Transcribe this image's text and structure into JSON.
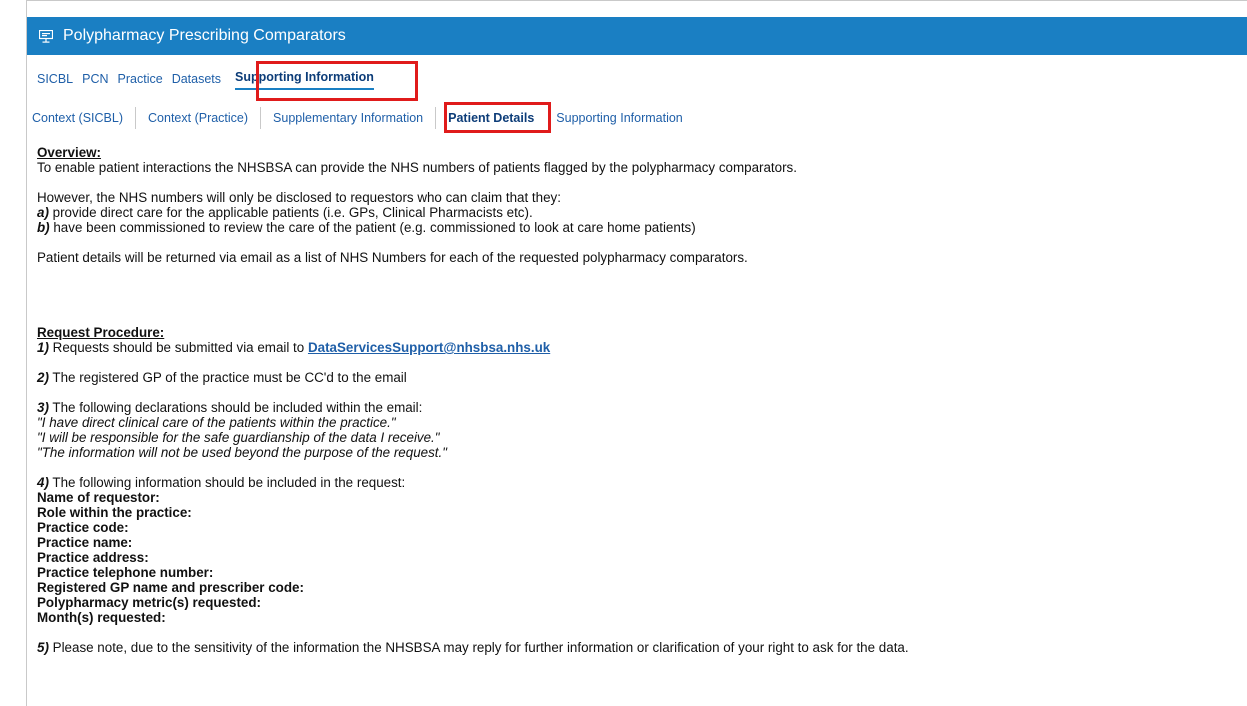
{
  "app": {
    "title": "Polypharmacy Prescribing Comparators",
    "icon": "presentation-board-icon",
    "header_color": "#1a7fc3"
  },
  "nav": {
    "tabs": [
      {
        "label": "SICBL"
      },
      {
        "label": "PCN"
      },
      {
        "label": "Practice"
      },
      {
        "label": "Datasets"
      },
      {
        "label": "Supporting Information",
        "active": true
      }
    ]
  },
  "subnav": {
    "tabs": [
      {
        "label": "Context (SICBL)"
      },
      {
        "label": "Context (Practice)"
      },
      {
        "label": "Supplementary Information"
      },
      {
        "label": "Patient Details",
        "active": true
      },
      {
        "label": "Supporting Information"
      }
    ]
  },
  "highlight_color": "#e01b1b",
  "content": {
    "overview_heading": "Overview:",
    "overview_text": "To enable patient interactions the NHSBSA can provide the NHS numbers of patients flagged by the polypharmacy comparators.",
    "disclosure_intro": "However, the NHS numbers will only be disclosed to requestors who can claim that they:",
    "criteria": [
      {
        "marker": "a)",
        "text": " provide direct care for the applicable patients (i.e. GPs, Clinical Pharmacists etc)."
      },
      {
        "marker": "b)",
        "text": " have been commissioned to review the care of the patient (e.g. commissioned to look at care home patients)"
      }
    ],
    "return_text": "Patient details will be returned via email as a list of NHS Numbers for each of the requested polypharmacy comparators.",
    "procedure_heading": "Request Procedure:",
    "step1_marker": "1)",
    "step1_text": " Requests should be submitted via email to ",
    "step1_email": "DataServicesSupport@nhsbsa.nhs.uk",
    "step2_marker": "2)",
    "step2_text": " The registered GP of the practice must be CC'd to the email",
    "step3_marker": "3)",
    "step3_text": " The following declarations should be included within the email:",
    "declarations": [
      "\"I have direct clinical care of the patients within the practice.\"",
      "\"I will be responsible for the safe guardianship of the data I receive.\"",
      "\"The information will not be used beyond the purpose of the request.\""
    ],
    "step4_marker": "4)",
    "step4_text": " The following information should be included in the request:",
    "fields": [
      "Name of requestor:",
      "Role within the practice:",
      "Practice code:",
      "Practice name:",
      "Practice address:",
      "Practice telephone number:",
      "Registered GP name and prescriber code:",
      "Polypharmacy metric(s) requested:",
      "Month(s) requested:"
    ],
    "step5_marker": "5)",
    "step5_text": " Please note, due to the sensitivity of the information the NHSBSA may reply for further information or clarification of your right to ask for the data."
  }
}
